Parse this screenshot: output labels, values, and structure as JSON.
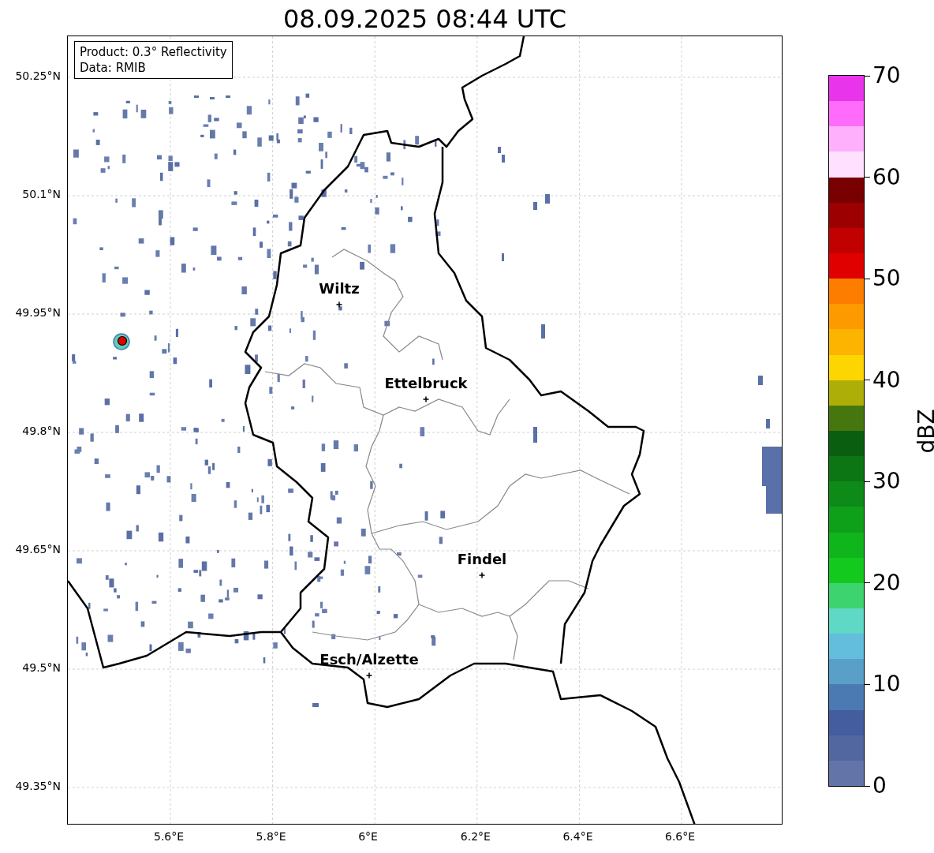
{
  "title": "08.09.2025 08:44 UTC",
  "info_box": {
    "lines": [
      "Product: 0.3° Reflectivity",
      "Data: RMIB"
    ]
  },
  "lat_ticks": [
    "50.25°N",
    "50.1°N",
    "49.95°N",
    "49.8°N",
    "49.65°N",
    "49.5°N",
    "49.35°N"
  ],
  "lon_ticks": [
    "5.6°E",
    "5.8°E",
    "6°E",
    "6.2°E",
    "6.4°E",
    "6.6°E"
  ],
  "cities": [
    {
      "name": "Wiltz"
    },
    {
      "name": "Ettelbruck"
    },
    {
      "name": "Findel"
    },
    {
      "name": "Esch/Alzette"
    }
  ],
  "colorbar": {
    "label": "dBZ",
    "ticks": [
      "70",
      "60",
      "50",
      "40",
      "30",
      "20",
      "10",
      "0"
    ],
    "bins": [
      {
        "color": "#e834ea"
      },
      {
        "color": "#ff6bfb"
      },
      {
        "color": "#ffb0fd"
      },
      {
        "color": "#ffe0fe"
      },
      {
        "color": "#780000"
      },
      {
        "color": "#9d0000"
      },
      {
        "color": "#c10000"
      },
      {
        "color": "#e10000"
      },
      {
        "color": "#fd7d00"
      },
      {
        "color": "#fd9a00"
      },
      {
        "color": "#fdb400"
      },
      {
        "color": "#fdd500"
      },
      {
        "color": "#aeae08"
      },
      {
        "color": "#46770e"
      },
      {
        "color": "#0a5e10"
      },
      {
        "color": "#0c7514"
      },
      {
        "color": "#0e8a18"
      },
      {
        "color": "#0fa01a"
      },
      {
        "color": "#10b51c"
      },
      {
        "color": "#13c91e"
      },
      {
        "color": "#3dd46f"
      },
      {
        "color": "#5fd8c6"
      },
      {
        "color": "#62bedc"
      },
      {
        "color": "#5a9fc8"
      },
      {
        "color": "#4a7ab1"
      },
      {
        "color": "#435d9f"
      },
      {
        "color": "#52679f"
      },
      {
        "color": "#6374a8"
      }
    ]
  }
}
